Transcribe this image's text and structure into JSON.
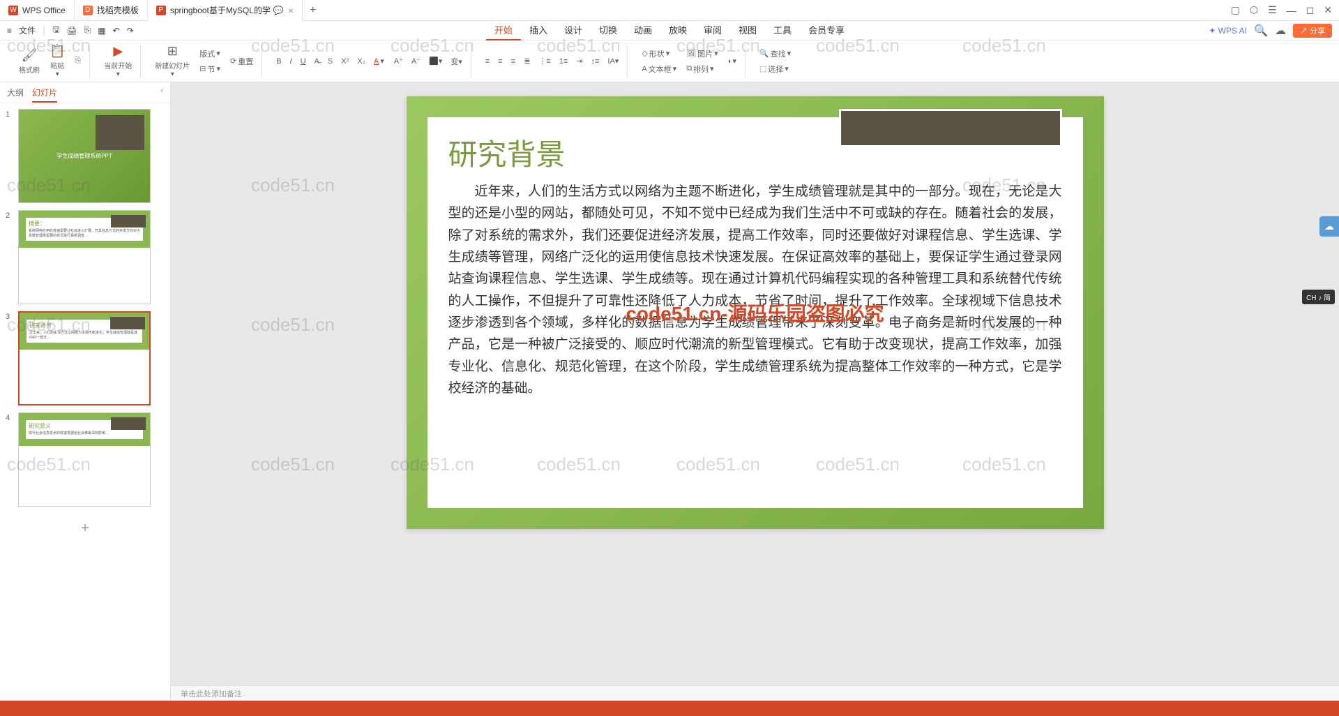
{
  "titlebar": {
    "tabs": [
      {
        "icon": "W",
        "label": "WPS Office"
      },
      {
        "icon": "D",
        "label": "找稻壳模板"
      },
      {
        "icon": "P",
        "label": "springboot基于MySQL的学",
        "closable": true
      }
    ],
    "add": "+",
    "window_controls": [
      "▢",
      "⬡",
      "☰",
      "—",
      "◻",
      "✕"
    ]
  },
  "quickbar": {
    "menu_icon": "≡",
    "file": "文件",
    "icons": [
      "🖫",
      "🖨",
      "↶",
      "↷"
    ],
    "right": {
      "cloud": "☁",
      "share": "分享"
    }
  },
  "menu_tabs": [
    "开始",
    "插入",
    "设计",
    "切换",
    "动画",
    "放映",
    "审阅",
    "视图",
    "工具",
    "会员专享"
  ],
  "wps_ai": "WPS AI",
  "ribbon": {
    "g1": {
      "format_painter": "格式刷",
      "paste": "粘贴"
    },
    "g2": {
      "from_current": "当前开始"
    },
    "g3": {
      "new_slide": "新建幻灯片",
      "layout": "版式",
      "section": "节",
      "reset": "重置"
    },
    "g4_font": {
      "size_up": "A⁺",
      "size_down": "A⁻"
    },
    "g5": {
      "shape": "形状",
      "picture": "图片",
      "textbox": "文本框",
      "arrange": "排列"
    },
    "g6": {
      "find": "查找",
      "select": "选择"
    }
  },
  "thumb_panel": {
    "tabs": [
      "大纲",
      "幻灯片"
    ],
    "slides": [
      {
        "num": "1",
        "title": "学生成绩管理系统PPT"
      },
      {
        "num": "2",
        "title": "摘要：",
        "preview": "系统网络应用的普遍需要让社会进入扩展，开具信息方式的并发方向对大多数管理类需要的状况进行系统调查…"
      },
      {
        "num": "3",
        "title": "研究背景",
        "preview": "近年来，人们的生活方式以网络为主题不断进化，学生成绩管理就是其中的一部分…"
      },
      {
        "num": "4",
        "title": "研究意义",
        "preview": "现今社会信息技术的快速发展给社会带来深刻影响…"
      }
    ],
    "add": "+"
  },
  "slide": {
    "title": "研究背景",
    "body": "近年来，人们的生活方式以网络为主题不断进化，学生成绩管理就是其中的一部分。现在，无论是大型的还是小型的网站，都随处可见，不知不觉中已经成为我们生活中不可或缺的存在。随着社会的发展，除了对系统的需求外，我们还要促进经济发展，提高工作效率，同时还要做好对课程信息、学生选课、学生成绩等管理，网络广泛化的运用使信息技术快速发展。在保证高效率的基础上，要保证学生通过登录网站查询课程信息、学生选课、学生成绩等。现在通过计算机代码编程实现的各种管理工具和系统替代传统的人工操作，不但提升了可靠性还降低了人力成本，节省了时间，提升了工作效率。全球视域下信息技术逐步渗透到各个领域，多样化的数据信息为学生成绩管理带来了深刻变革。电子商务是新时代发展的一种产品，它是一种被广泛接受的、顺应时代潮流的新型管理模式。它有助于改变现状，提高工作效率，加强专业化、信息化、规范化管理，在这个阶段，学生成绩管理系统为提高整体工作效率的一种方式，它是学校经济的基础。",
    "watermark_center": "code51.cn-源码乐园盗图必究"
  },
  "notes": "单击此处添加备注",
  "ime": "CH ♪ 简",
  "watermark": "code51.cn"
}
